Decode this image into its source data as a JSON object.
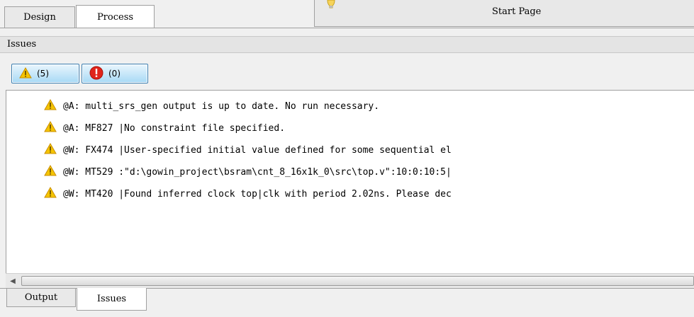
{
  "top_tabs": {
    "design": "Design",
    "process": "Process",
    "start_page": "Start Page"
  },
  "issues_panel": {
    "title": "Issues",
    "filters": {
      "warnings": {
        "count_label": "(5)",
        "icon": "warning-icon"
      },
      "errors": {
        "count_label": "(0)",
        "icon": "error-icon"
      }
    },
    "messages": [
      {
        "icon": "warning-icon",
        "text": "@A: multi_srs_gen output is up to date. No run necessary."
      },
      {
        "icon": "warning-icon",
        "text": "@A: MF827 |No constraint file specified."
      },
      {
        "icon": "warning-icon",
        "text": "@W: FX474 |User-specified initial value defined for some sequential el"
      },
      {
        "icon": "warning-icon",
        "text": "@W: MT529 :\"d:\\gowin_project\\bsram\\cnt_8_16x1k_0\\src\\top.v\":10:0:10:5|"
      },
      {
        "icon": "warning-icon",
        "text": "@W: MT420 |Found inferred clock top|clk with period 2.02ns. Please dec"
      }
    ]
  },
  "bottom_tabs": {
    "output": "Output",
    "issues": "Issues"
  },
  "colors": {
    "warning": "#f5c400",
    "error": "#e0241b",
    "button_border": "#3c7fb1"
  }
}
